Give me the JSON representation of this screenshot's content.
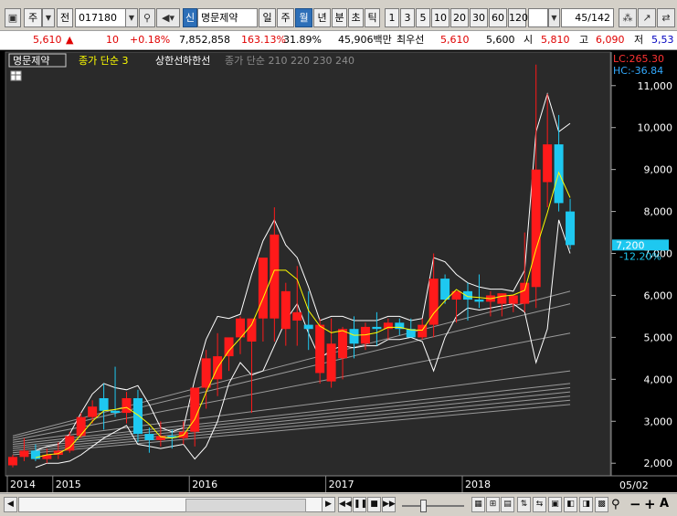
{
  "toolbar": {
    "market_label": "주",
    "all_label": "전",
    "code": "017180",
    "new_badge": "신",
    "company": "명문제약",
    "periods": [
      "일",
      "주",
      "월",
      "년"
    ],
    "selected_period": "월",
    "minute_units": [
      "분",
      "초",
      "틱"
    ],
    "intervals": [
      "1",
      "3",
      "5",
      "10",
      "20",
      "30",
      "60",
      "120"
    ],
    "page_indicator": "45/142",
    "icons": [
      "search-icon",
      "speaker-icon",
      "settings-icon",
      "link-chart-icon",
      "restore-icon"
    ]
  },
  "quote": {
    "price": "5,610",
    "direction": "▲",
    "change": "10",
    "change_pct": "+0.18%",
    "volume": "7,852,858",
    "volume_ratio": "163.13%",
    "turnover": "31.89%",
    "amount": "45,906백만",
    "pref_label": "최우선",
    "pref_ask": "5,610",
    "pref_bid": "5,600",
    "open_label": "시",
    "open": "5,810",
    "high_label": "고",
    "high": "6,090",
    "low_label": "저",
    "low": "5,53"
  },
  "legend": {
    "stock": "명문제약",
    "ma_label": "종가 단순 3",
    "upper": "상한선",
    "lower": "하한선",
    "long_ma": "종가 단순 210 220 230 240"
  },
  "colors": {
    "up": "#ff1a1a",
    "down": "#1ec8f0",
    "ma": "#ffff00",
    "band": "#ffffff",
    "long_ma": "#9a9a9a",
    "axis_text": "#ffffff",
    "price_box": "#1ec8f0",
    "lc": "#ff3333",
    "hc": "#33aaff"
  },
  "axis": {
    "lc": "LC:265.30",
    "hc": "HC:-36.84",
    "current_price": "7,200",
    "current_pct": "-12.20%",
    "date_corner": "05/02",
    "year_labels": [
      {
        "text": "2014",
        "index": 0
      },
      {
        "text": "2015",
        "index": 4
      },
      {
        "text": "2016",
        "index": 16
      },
      {
        "text": "2017",
        "index": 28
      },
      {
        "text": "2018",
        "index": 40
      }
    ]
  },
  "chart_data": {
    "type": "candlestick",
    "ylim": [
      1700,
      11800
    ],
    "yticks": [
      2000,
      3000,
      4000,
      5000,
      6000,
      7000,
      8000,
      9000,
      10000,
      11000
    ],
    "candles": [
      {
        "o": 1950,
        "h": 2200,
        "l": 1900,
        "c": 2150
      },
      {
        "o": 2150,
        "h": 2600,
        "l": 2050,
        "c": 2300
      },
      {
        "o": 2300,
        "h": 2450,
        "l": 2050,
        "c": 2100
      },
      {
        "o": 2100,
        "h": 2350,
        "l": 2000,
        "c": 2200
      },
      {
        "o": 2200,
        "h": 2500,
        "l": 2100,
        "c": 2300
      },
      {
        "o": 2300,
        "h": 2750,
        "l": 2250,
        "c": 2650
      },
      {
        "o": 2650,
        "h": 3200,
        "l": 2600,
        "c": 3100
      },
      {
        "o": 3100,
        "h": 3500,
        "l": 2950,
        "c": 3350
      },
      {
        "o": 3550,
        "h": 3900,
        "l": 2800,
        "c": 3250
      },
      {
        "o": 3250,
        "h": 4300,
        "l": 3100,
        "c": 3200
      },
      {
        "o": 3200,
        "h": 3700,
        "l": 2950,
        "c": 3550
      },
      {
        "o": 3550,
        "h": 3750,
        "l": 2500,
        "c": 2700
      },
      {
        "o": 2700,
        "h": 2850,
        "l": 2250,
        "c": 2550
      },
      {
        "o": 2550,
        "h": 3000,
        "l": 2400,
        "c": 2650
      },
      {
        "o": 2650,
        "h": 2800,
        "l": 2350,
        "c": 2600
      },
      {
        "o": 2600,
        "h": 3000,
        "l": 2450,
        "c": 2750
      },
      {
        "o": 2750,
        "h": 3200,
        "l": 2400,
        "c": 3800
      },
      {
        "o": 3800,
        "h": 4700,
        "l": 3300,
        "c": 4500
      },
      {
        "o": 4000,
        "h": 5100,
        "l": 3600,
        "c": 4550
      },
      {
        "o": 4550,
        "h": 4950,
        "l": 4200,
        "c": 5000
      },
      {
        "o": 5000,
        "h": 5500,
        "l": 4600,
        "c": 5450
      },
      {
        "o": 4900,
        "h": 5300,
        "l": 3200,
        "c": 5450
      },
      {
        "o": 5450,
        "h": 6300,
        "l": 4900,
        "c": 6900
      },
      {
        "o": 5450,
        "h": 8100,
        "l": 4900,
        "c": 7450
      },
      {
        "o": 5200,
        "h": 6300,
        "l": 4800,
        "c": 6100
      },
      {
        "o": 5400,
        "h": 6700,
        "l": 4800,
        "c": 5600
      },
      {
        "o": 5300,
        "h": 6100,
        "l": 4700,
        "c": 5200
      },
      {
        "o": 4150,
        "h": 5450,
        "l": 3900,
        "c": 5300
      },
      {
        "o": 3950,
        "h": 5450,
        "l": 3800,
        "c": 4850
      },
      {
        "o": 4500,
        "h": 5250,
        "l": 4000,
        "c": 5200
      },
      {
        "o": 5200,
        "h": 5500,
        "l": 4500,
        "c": 4850
      },
      {
        "o": 4850,
        "h": 5350,
        "l": 4700,
        "c": 5250
      },
      {
        "o": 5250,
        "h": 5600,
        "l": 4800,
        "c": 5200
      },
      {
        "o": 5200,
        "h": 5450,
        "l": 4950,
        "c": 5350
      },
      {
        "o": 5350,
        "h": 5450,
        "l": 5050,
        "c": 5200
      },
      {
        "o": 5200,
        "h": 5450,
        "l": 5000,
        "c": 5000
      },
      {
        "o": 5000,
        "h": 5450,
        "l": 4950,
        "c": 5300
      },
      {
        "o": 5300,
        "h": 7000,
        "l": 5000,
        "c": 6400
      },
      {
        "o": 6400,
        "h": 6500,
        "l": 5800,
        "c": 5900
      },
      {
        "o": 5900,
        "h": 6100,
        "l": 5350,
        "c": 6100
      },
      {
        "o": 6100,
        "h": 6300,
        "l": 5400,
        "c": 5900
      },
      {
        "o": 5900,
        "h": 6500,
        "l": 5700,
        "c": 5850
      },
      {
        "o": 5850,
        "h": 6100,
        "l": 5500,
        "c": 6000
      },
      {
        "o": 5800,
        "h": 6050,
        "l": 5500,
        "c": 6050
      },
      {
        "o": 5800,
        "h": 6000,
        "l": 5600,
        "c": 6000
      },
      {
        "o": 5800,
        "h": 7500,
        "l": 5600,
        "c": 6300
      },
      {
        "o": 6200,
        "h": 11500,
        "l": 5700,
        "c": 9000
      },
      {
        "o": 8700,
        "h": 10800,
        "l": 8100,
        "c": 9600
      },
      {
        "o": 9600,
        "h": 10300,
        "l": 8000,
        "c": 8200
      },
      {
        "o": 8000,
        "h": 8300,
        "l": 7100,
        "c": 7200
      }
    ],
    "ma3": [
      null,
      null,
      2130,
      2200,
      2230,
      2380,
      2680,
      3000,
      3250,
      3280,
      3330,
      3150,
      2930,
      2630,
      2600,
      2670,
      3050,
      3690,
      4280,
      4680,
      4980,
      5300,
      5930,
      6600,
      6600,
      6380,
      5640,
      5270,
      5110,
      5160,
      5050,
      5060,
      5110,
      5240,
      5240,
      5180,
      5170,
      5570,
      5870,
      6140,
      5970,
      5950,
      5920,
      5980,
      6010,
      6120,
      7100,
      7970,
      8930,
      8330
    ],
    "upper": [
      null,
      null,
      2300,
      2400,
      2450,
      2700,
      3200,
      3650,
      3900,
      3800,
      3750,
      3850,
      3400,
      2850,
      2750,
      2850,
      4000,
      4950,
      5500,
      5450,
      5550,
      6500,
      7300,
      7800,
      7200,
      6900,
      6200,
      5400,
      5500,
      5500,
      5400,
      5400,
      5400,
      5500,
      5500,
      5400,
      5450,
      6900,
      6800,
      6500,
      6300,
      6200,
      6150,
      6150,
      6100,
      6600,
      9900,
      10800,
      9900,
      10100
    ],
    "lower": [
      null,
      null,
      1900,
      2000,
      2000,
      2050,
      2200,
      2400,
      2600,
      2750,
      2900,
      2450,
      2400,
      2350,
      2400,
      2450,
      2100,
      2400,
      3000,
      3900,
      4400,
      4100,
      4200,
      4800,
      5400,
      5800,
      5100,
      4500,
      4700,
      4800,
      4750,
      4800,
      4800,
      4950,
      4950,
      5000,
      4900,
      4200,
      5000,
      5500,
      5700,
      5650,
      5700,
      5750,
      5800,
      5600,
      4400,
      5200,
      7800,
      7000
    ],
    "long_ma": [
      {
        "start": 2650,
        "end": 6100
      },
      {
        "start": 2600,
        "end": 5800
      },
      {
        "start": 2550,
        "end": 5100
      },
      {
        "start": 2500,
        "end": 4200
      },
      {
        "start": 2450,
        "end": 3900
      },
      {
        "start": 2400,
        "end": 3800
      },
      {
        "start": 2350,
        "end": 3700
      },
      {
        "start": 2300,
        "end": 3600
      },
      {
        "start": 2250,
        "end": 3500
      },
      {
        "start": 2200,
        "end": 3400
      }
    ]
  },
  "statusbar": {
    "buttons": [
      "rewind-icon",
      "pause-icon",
      "stop-icon",
      "forward-icon"
    ],
    "tools": [
      "zoom-out-icon",
      "minus-icon",
      "plus-icon",
      "text-icon"
    ],
    "text_tool": "A"
  }
}
